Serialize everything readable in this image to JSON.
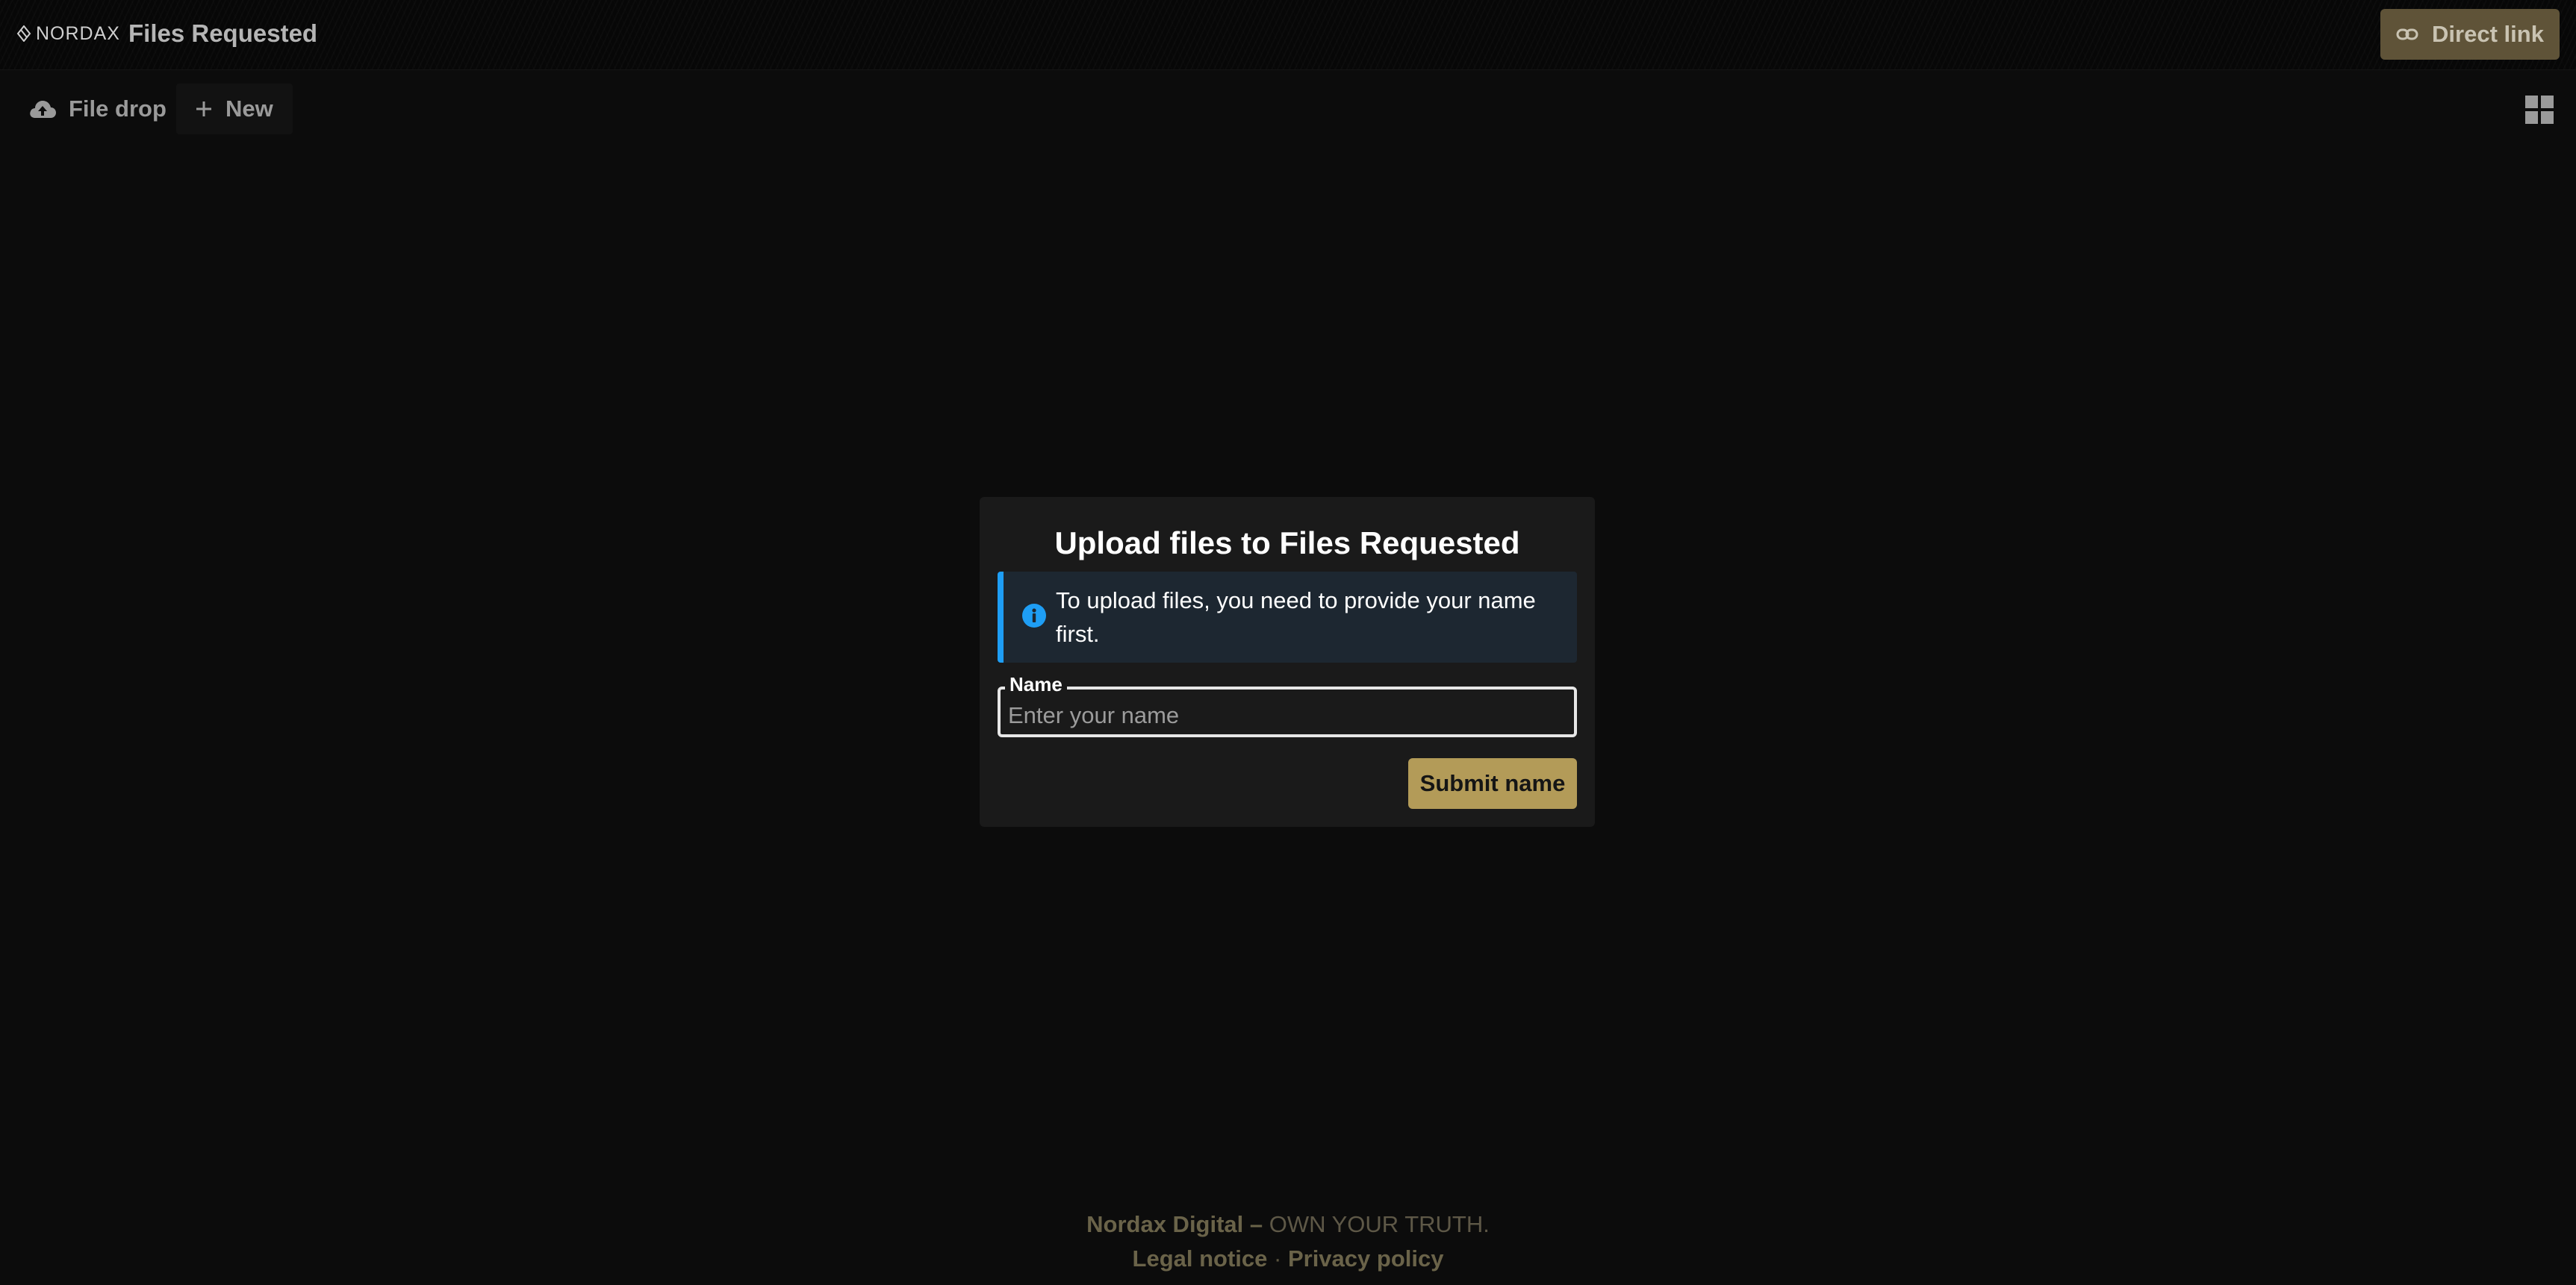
{
  "header": {
    "logo_text": "NORDAX",
    "app_title": "Files Requested",
    "direct_link_label": "Direct link"
  },
  "toolbar": {
    "file_drop_label": "File drop",
    "new_label": "New"
  },
  "upload_card": {
    "title": "Upload files to Files Requested",
    "alert_text": "To upload files, you need to provide your name first.",
    "name_label": "Name",
    "name_placeholder": "Enter your name",
    "name_value": "",
    "submit_label": "Submit name"
  },
  "footer": {
    "company": "Nordax Digital",
    "separator": " – ",
    "tagline": "OWN YOUR TRUTH.",
    "legal_notice": "Legal notice",
    "dot": " · ",
    "privacy_policy": "Privacy policy"
  },
  "colors": {
    "accent_gold": "#b39b58",
    "info_blue": "#1e9ef5",
    "background": "#0c0c0c"
  },
  "icons": {
    "direct_link": "link-icon",
    "file_drop": "cloud-upload-icon",
    "new": "plus-icon",
    "view_toggle": "grid-view-icon",
    "alert": "info-icon"
  }
}
